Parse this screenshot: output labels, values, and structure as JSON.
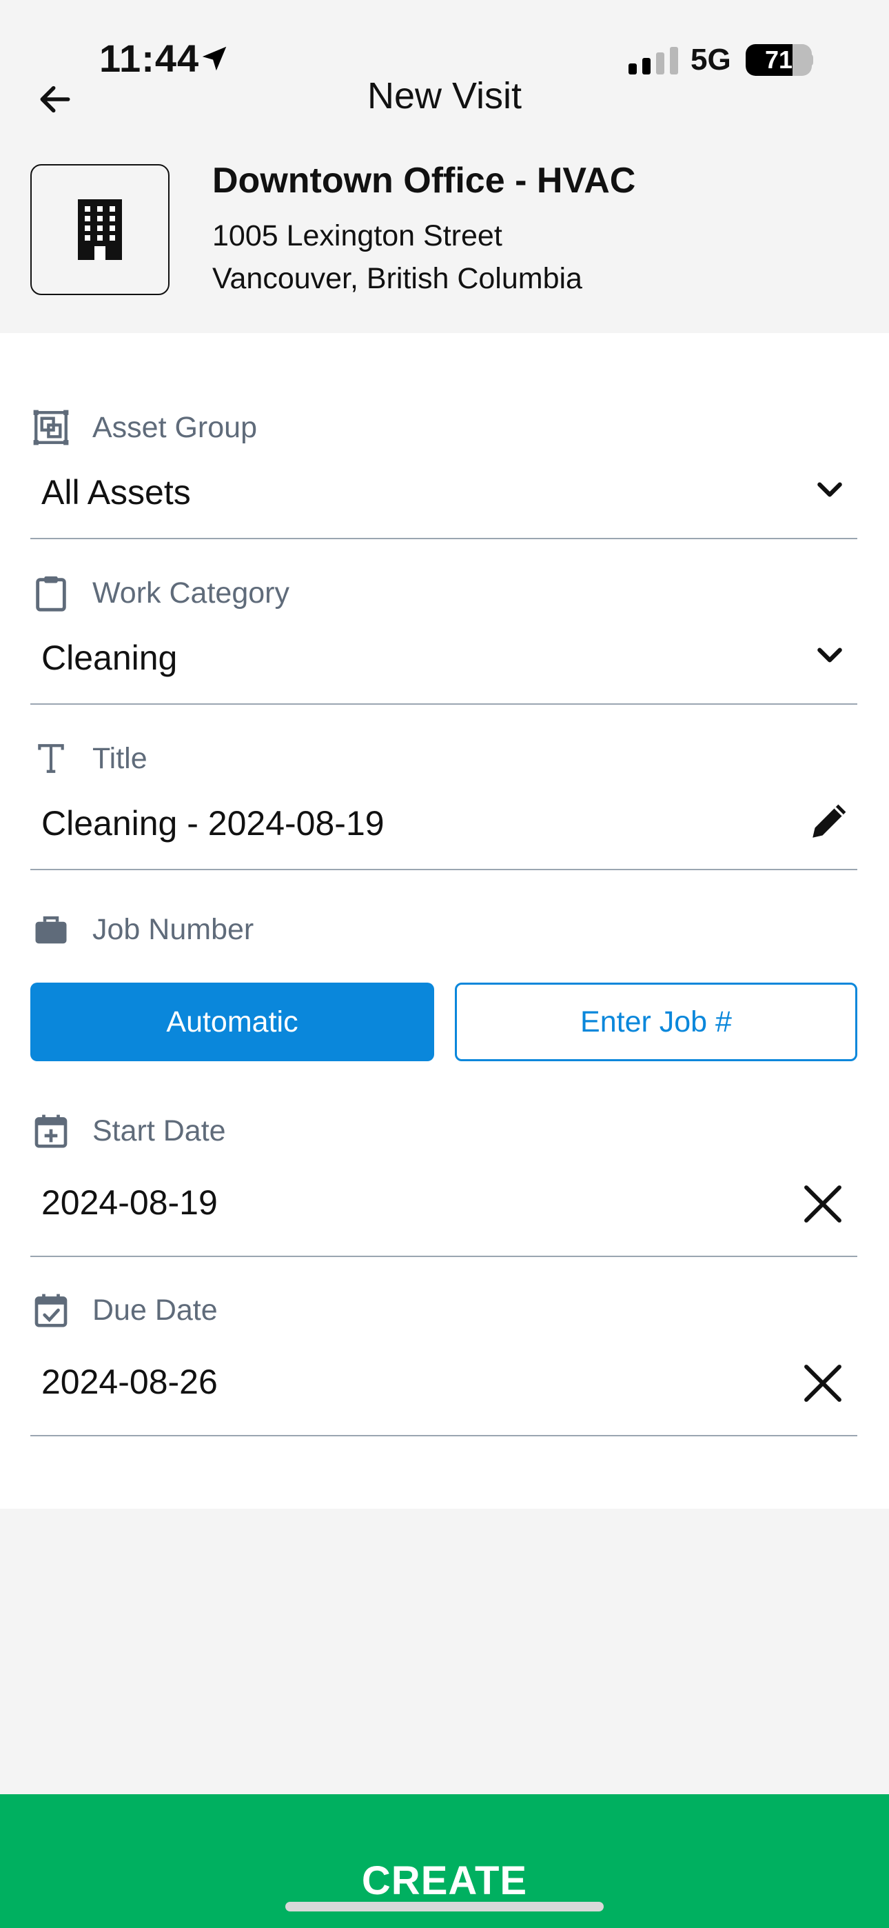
{
  "status_bar": {
    "time": "11:44",
    "network": "5G",
    "battery_percent": "71",
    "battery_level": 0.71
  },
  "nav": {
    "title": "New Visit",
    "back_icon": "arrow-left-icon"
  },
  "site": {
    "icon": "building-icon",
    "name": "Downtown Office - HVAC",
    "address_line1": "1005 Lexington Street",
    "address_line2": "Vancouver, British Columbia"
  },
  "form": {
    "asset_group": {
      "label": "Asset Group",
      "value": "All Assets",
      "icon": "asset-group-icon",
      "action_icon": "chevron-down-icon"
    },
    "work_category": {
      "label": "Work Category",
      "value": "Cleaning",
      "icon": "clipboard-icon",
      "action_icon": "chevron-down-icon"
    },
    "title": {
      "label": "Title",
      "value": "Cleaning - 2024-08-19",
      "icon": "text-icon",
      "action_icon": "pencil-icon"
    },
    "job_number": {
      "label": "Job Number",
      "icon": "briefcase-icon",
      "options": [
        "Automatic",
        "Enter Job #"
      ],
      "selected": "Automatic"
    },
    "start_date": {
      "label": "Start Date",
      "value": "2024-08-19",
      "icon": "calendar-plus-icon",
      "action_icon": "close-icon"
    },
    "due_date": {
      "label": "Due Date",
      "value": "2024-08-26",
      "icon": "calendar-check-icon",
      "action_icon": "close-icon"
    }
  },
  "create_label": "CREATE",
  "colors": {
    "primary_blue": "#0a87db",
    "create_green": "#00b060",
    "label_gray": "#5f6b7a",
    "divider": "#9aa5b1"
  }
}
